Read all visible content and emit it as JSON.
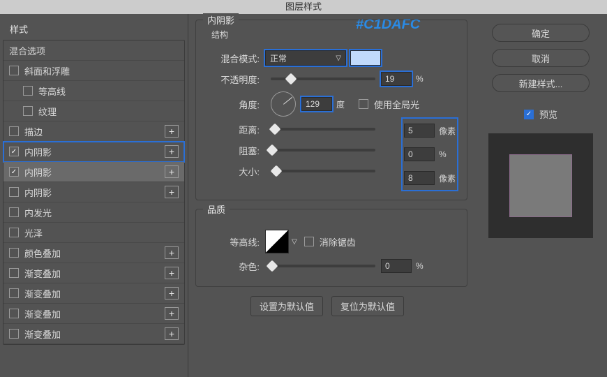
{
  "title": "图层样式",
  "annotation": "#C1DAFC",
  "sidebar": {
    "heading": "样式",
    "blend": "混合选项",
    "items": [
      {
        "label": "斜面和浮雕",
        "checked": false,
        "indent": false,
        "plus": false
      },
      {
        "label": "等高线",
        "checked": false,
        "indent": true,
        "plus": false
      },
      {
        "label": "纹理",
        "checked": false,
        "indent": true,
        "plus": false
      },
      {
        "label": "描边",
        "checked": false,
        "indent": false,
        "plus": true
      },
      {
        "label": "内阴影",
        "checked": true,
        "indent": false,
        "plus": true,
        "highlight": true
      },
      {
        "label": "内阴影",
        "checked": true,
        "indent": false,
        "plus": true,
        "selected": true
      },
      {
        "label": "内阴影",
        "checked": false,
        "indent": false,
        "plus": true
      },
      {
        "label": "内发光",
        "checked": false,
        "indent": false,
        "plus": false
      },
      {
        "label": "光泽",
        "checked": false,
        "indent": false,
        "plus": false
      },
      {
        "label": "颜色叠加",
        "checked": false,
        "indent": false,
        "plus": true
      },
      {
        "label": "渐变叠加",
        "checked": false,
        "indent": false,
        "plus": true
      },
      {
        "label": "渐变叠加",
        "checked": false,
        "indent": false,
        "plus": true
      },
      {
        "label": "渐变叠加",
        "checked": false,
        "indent": false,
        "plus": true
      },
      {
        "label": "渐变叠加",
        "checked": false,
        "indent": false,
        "plus": true
      }
    ]
  },
  "panel": {
    "title": "内阴影",
    "section_struct": "结构",
    "blend_mode_label": "混合模式:",
    "blend_mode_value": "正常",
    "opacity_label": "不透明度:",
    "opacity_value": "19",
    "opacity_unit": "%",
    "angle_label": "角度:",
    "angle_value": "129",
    "angle_unit": "度",
    "global_light": "使用全局光",
    "distance_label": "距离:",
    "distance_value": "5",
    "distance_unit": "像素",
    "choke_label": "阻塞:",
    "choke_value": "0",
    "choke_unit": "%",
    "size_label": "大小:",
    "size_value": "8",
    "size_unit": "像素",
    "section_quality": "品质",
    "contour_label": "等高线:",
    "antialias": "消除锯齿",
    "noise_label": "杂色:",
    "noise_value": "0",
    "noise_unit": "%",
    "reset_default": "设置为默认值",
    "restore_default": "复位为默认值"
  },
  "right": {
    "ok": "确定",
    "cancel": "取消",
    "new_style": "新建样式...",
    "preview": "预览"
  },
  "colors": {
    "swatch": "#C1DAFC"
  }
}
